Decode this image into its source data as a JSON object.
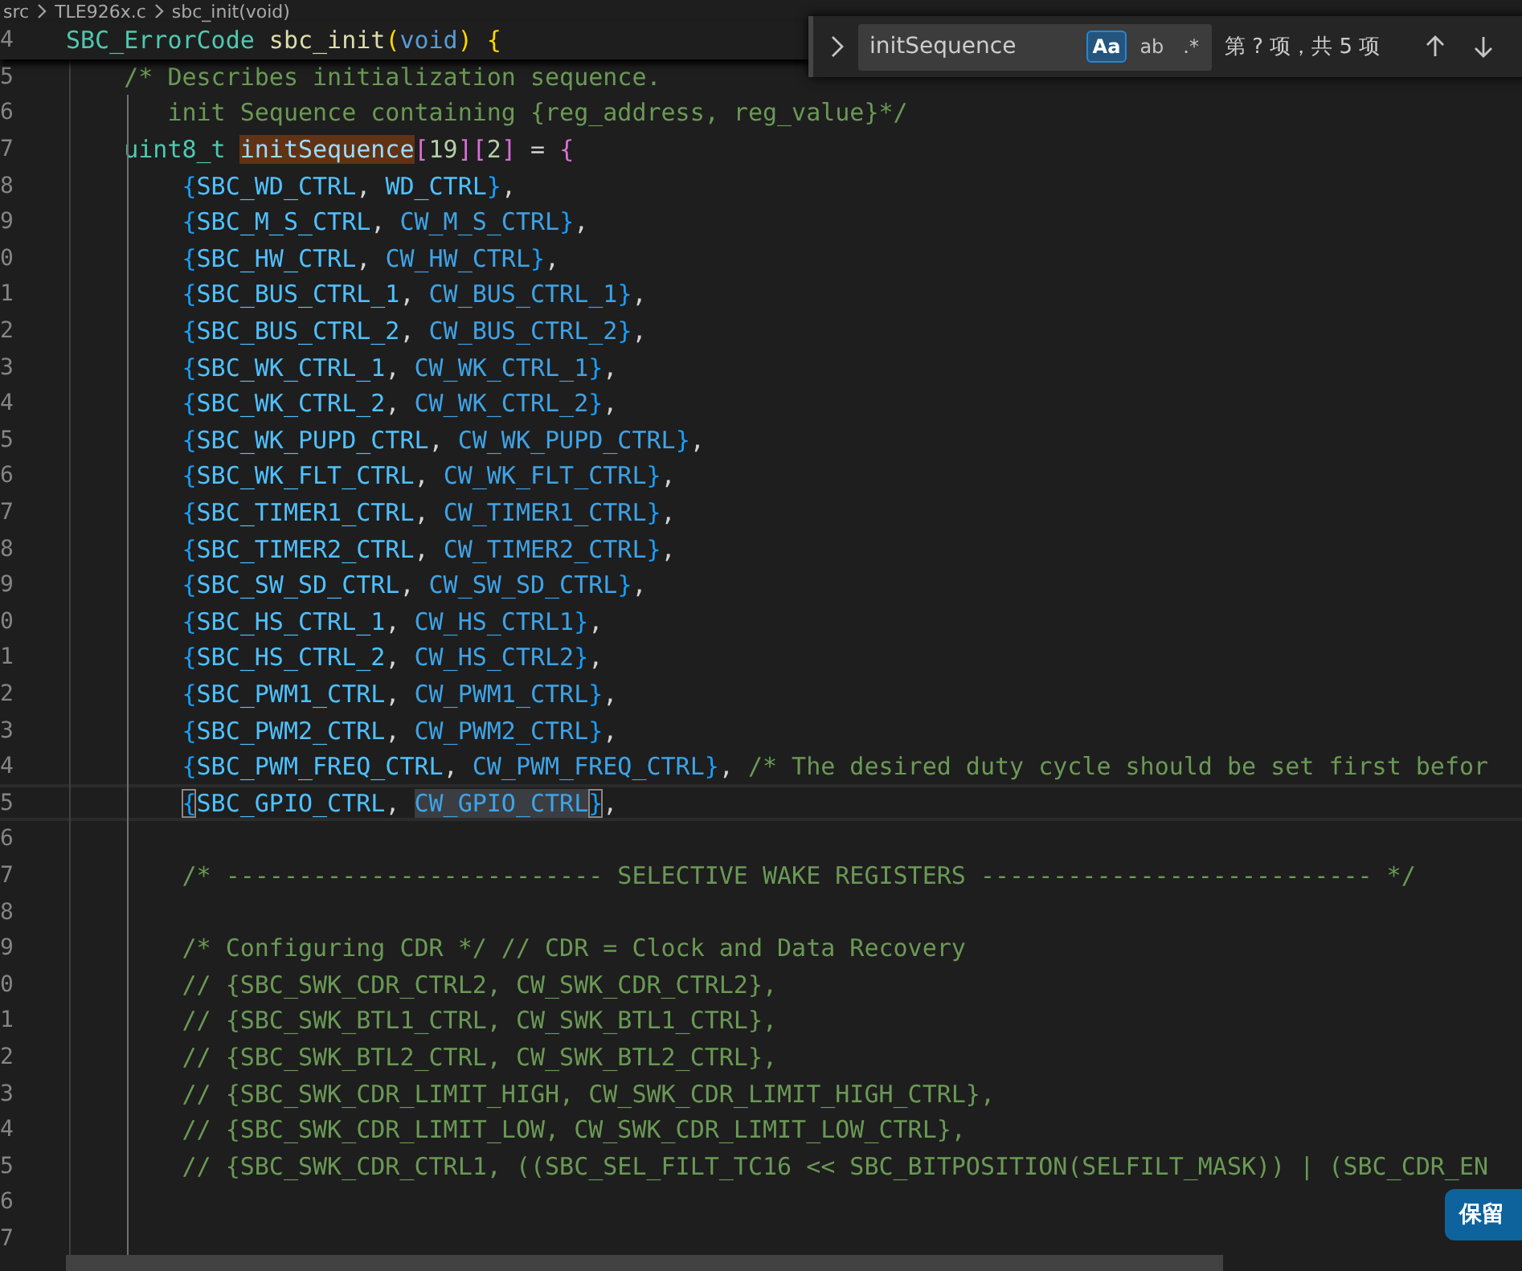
{
  "breadcrumb": [
    "src",
    "TLE926x.c",
    "sbc_init(void)"
  ],
  "sticky_line": {
    "number": "4",
    "tokens": [
      {
        "text": "SBC_ErrorCode",
        "kind": "type"
      },
      {
        "text": " sbc_init",
        "kind": "func"
      },
      {
        "text": "(",
        "kind": "p1"
      },
      {
        "text": "void",
        "kind": "kw"
      },
      {
        "text": ")",
        "kind": "p1"
      },
      {
        "text": " {",
        "kind": "p1"
      }
    ]
  },
  "lines": [
    {
      "number": "5",
      "current": false,
      "tokens": [
        {
          "text": "    /* Describes initialization sequence.",
          "kind": "comment"
        }
      ]
    },
    {
      "number": "6",
      "current": false,
      "tokens": [
        {
          "text": "       init Sequence containing {reg_address, reg_value}*/",
          "kind": "comment"
        }
      ]
    },
    {
      "number": "7",
      "current": false,
      "tokens": [
        {
          "text": "    uint8_t ",
          "kind": "type"
        },
        {
          "text": "initSequence",
          "kind": "var",
          "find_match": true
        },
        {
          "text": "[",
          "kind": "p2"
        },
        {
          "text": "19",
          "kind": "num"
        },
        {
          "text": "]",
          "kind": "p2"
        },
        {
          "text": "[",
          "kind": "p2"
        },
        {
          "text": "2",
          "kind": "num"
        },
        {
          "text": "]",
          "kind": "p2"
        },
        {
          "text": " =",
          "kind": "plain"
        },
        {
          "text": " {",
          "kind": "p2"
        }
      ]
    },
    {
      "number": "8",
      "current": false,
      "tokens": [
        {
          "text": "        {",
          "kind": "p3"
        },
        {
          "text": "SBC_WD_CTRL",
          "kind": "const"
        },
        {
          "text": ",",
          "kind": "plain"
        },
        {
          "text": " WD_CTRL",
          "kind": "const"
        },
        {
          "text": "}",
          "kind": "p3"
        },
        {
          "text": ",",
          "kind": "plain"
        }
      ]
    },
    {
      "number": "9",
      "current": false,
      "tokens": [
        {
          "text": "        {",
          "kind": "p3"
        },
        {
          "text": "SBC_M_S_CTRL",
          "kind": "const"
        },
        {
          "text": ",",
          "kind": "plain"
        },
        {
          "text": " CW_M_S_CTRL",
          "kind": "macro"
        },
        {
          "text": "}",
          "kind": "p3"
        },
        {
          "text": ",",
          "kind": "plain"
        }
      ]
    },
    {
      "number": "0",
      "current": false,
      "tokens": [
        {
          "text": "        {",
          "kind": "p3"
        },
        {
          "text": "SBC_HW_CTRL",
          "kind": "const"
        },
        {
          "text": ",",
          "kind": "plain"
        },
        {
          "text": " CW_HW_CTRL",
          "kind": "macro"
        },
        {
          "text": "}",
          "kind": "p3"
        },
        {
          "text": ",",
          "kind": "plain"
        }
      ]
    },
    {
      "number": "1",
      "current": false,
      "tokens": [
        {
          "text": "        {",
          "kind": "p3"
        },
        {
          "text": "SBC_BUS_CTRL_1",
          "kind": "const"
        },
        {
          "text": ",",
          "kind": "plain"
        },
        {
          "text": " CW_BUS_CTRL_1",
          "kind": "macro"
        },
        {
          "text": "}",
          "kind": "p3"
        },
        {
          "text": ",",
          "kind": "plain"
        }
      ]
    },
    {
      "number": "2",
      "current": false,
      "tokens": [
        {
          "text": "        {",
          "kind": "p3"
        },
        {
          "text": "SBC_BUS_CTRL_2",
          "kind": "const"
        },
        {
          "text": ",",
          "kind": "plain"
        },
        {
          "text": " CW_BUS_CTRL_2",
          "kind": "macro"
        },
        {
          "text": "}",
          "kind": "p3"
        },
        {
          "text": ",",
          "kind": "plain"
        }
      ]
    },
    {
      "number": "3",
      "current": false,
      "tokens": [
        {
          "text": "        {",
          "kind": "p3"
        },
        {
          "text": "SBC_WK_CTRL_1",
          "kind": "const"
        },
        {
          "text": ",",
          "kind": "plain"
        },
        {
          "text": " CW_WK_CTRL_1",
          "kind": "macro"
        },
        {
          "text": "}",
          "kind": "p3"
        },
        {
          "text": ",",
          "kind": "plain"
        }
      ]
    },
    {
      "number": "4",
      "current": false,
      "tokens": [
        {
          "text": "        {",
          "kind": "p3"
        },
        {
          "text": "SBC_WK_CTRL_2",
          "kind": "const"
        },
        {
          "text": ",",
          "kind": "plain"
        },
        {
          "text": " CW_WK_CTRL_2",
          "kind": "macro"
        },
        {
          "text": "}",
          "kind": "p3"
        },
        {
          "text": ",",
          "kind": "plain"
        }
      ]
    },
    {
      "number": "5",
      "current": false,
      "tokens": [
        {
          "text": "        {",
          "kind": "p3"
        },
        {
          "text": "SBC_WK_PUPD_CTRL",
          "kind": "const"
        },
        {
          "text": ",",
          "kind": "plain"
        },
        {
          "text": " CW_WK_PUPD_CTRL",
          "kind": "macro"
        },
        {
          "text": "}",
          "kind": "p3"
        },
        {
          "text": ",",
          "kind": "plain"
        }
      ]
    },
    {
      "number": "6",
      "current": false,
      "tokens": [
        {
          "text": "        {",
          "kind": "p3"
        },
        {
          "text": "SBC_WK_FLT_CTRL",
          "kind": "const"
        },
        {
          "text": ",",
          "kind": "plain"
        },
        {
          "text": " CW_WK_FLT_CTRL",
          "kind": "macro"
        },
        {
          "text": "}",
          "kind": "p3"
        },
        {
          "text": ",",
          "kind": "plain"
        }
      ]
    },
    {
      "number": "7",
      "current": false,
      "tokens": [
        {
          "text": "        {",
          "kind": "p3"
        },
        {
          "text": "SBC_TIMER1_CTRL",
          "kind": "const"
        },
        {
          "text": ",",
          "kind": "plain"
        },
        {
          "text": " CW_TIMER1_CTRL",
          "kind": "macro"
        },
        {
          "text": "}",
          "kind": "p3"
        },
        {
          "text": ",",
          "kind": "plain"
        }
      ]
    },
    {
      "number": "8",
      "current": false,
      "tokens": [
        {
          "text": "        {",
          "kind": "p3"
        },
        {
          "text": "SBC_TIMER2_CTRL",
          "kind": "const"
        },
        {
          "text": ",",
          "kind": "plain"
        },
        {
          "text": " CW_TIMER2_CTRL",
          "kind": "macro"
        },
        {
          "text": "}",
          "kind": "p3"
        },
        {
          "text": ",",
          "kind": "plain"
        }
      ]
    },
    {
      "number": "9",
      "current": false,
      "tokens": [
        {
          "text": "        {",
          "kind": "p3"
        },
        {
          "text": "SBC_SW_SD_CTRL",
          "kind": "const"
        },
        {
          "text": ",",
          "kind": "plain"
        },
        {
          "text": " CW_SW_SD_CTRL",
          "kind": "macro"
        },
        {
          "text": "}",
          "kind": "p3"
        },
        {
          "text": ",",
          "kind": "plain"
        }
      ]
    },
    {
      "number": "0",
      "current": false,
      "tokens": [
        {
          "text": "        {",
          "kind": "p3"
        },
        {
          "text": "SBC_HS_CTRL_1",
          "kind": "const"
        },
        {
          "text": ",",
          "kind": "plain"
        },
        {
          "text": " CW_HS_CTRL1",
          "kind": "macro"
        },
        {
          "text": "}",
          "kind": "p3"
        },
        {
          "text": ",",
          "kind": "plain"
        }
      ]
    },
    {
      "number": "1",
      "current": false,
      "tokens": [
        {
          "text": "        {",
          "kind": "p3"
        },
        {
          "text": "SBC_HS_CTRL_2",
          "kind": "const"
        },
        {
          "text": ",",
          "kind": "plain"
        },
        {
          "text": " CW_HS_CTRL2",
          "kind": "macro"
        },
        {
          "text": "}",
          "kind": "p3"
        },
        {
          "text": ",",
          "kind": "plain"
        }
      ]
    },
    {
      "number": "2",
      "current": false,
      "tokens": [
        {
          "text": "        {",
          "kind": "p3"
        },
        {
          "text": "SBC_PWM1_CTRL",
          "kind": "const"
        },
        {
          "text": ",",
          "kind": "plain"
        },
        {
          "text": " CW_PWM1_CTRL",
          "kind": "macro"
        },
        {
          "text": "}",
          "kind": "p3"
        },
        {
          "text": ",",
          "kind": "plain"
        }
      ]
    },
    {
      "number": "3",
      "current": false,
      "tokens": [
        {
          "text": "        {",
          "kind": "p3"
        },
        {
          "text": "SBC_PWM2_CTRL",
          "kind": "const"
        },
        {
          "text": ",",
          "kind": "plain"
        },
        {
          "text": " CW_PWM2_CTRL",
          "kind": "macro"
        },
        {
          "text": "}",
          "kind": "p3"
        },
        {
          "text": ",",
          "kind": "plain"
        }
      ]
    },
    {
      "number": "4",
      "current": false,
      "tokens": [
        {
          "text": "        {",
          "kind": "p3"
        },
        {
          "text": "SBC_PWM_FREQ_CTRL",
          "kind": "const"
        },
        {
          "text": ",",
          "kind": "plain"
        },
        {
          "text": " CW_PWM_FREQ_CTRL",
          "kind": "macro"
        },
        {
          "text": "}",
          "kind": "p3"
        },
        {
          "text": ",",
          "kind": "plain"
        },
        {
          "text": " /* The desired duty cycle should be set first befor",
          "kind": "comment"
        }
      ]
    },
    {
      "number": "5",
      "current": true,
      "tokens": [
        {
          "text": "        {",
          "kind": "p3",
          "bracket_match": true
        },
        {
          "text": "SBC_GPIO_CTRL",
          "kind": "const"
        },
        {
          "text": ", ",
          "kind": "plain"
        },
        {
          "text": "CW_GPIO_CTRL",
          "kind": "macro",
          "selected_text": true
        },
        {
          "text": "}",
          "kind": "p3",
          "bracket_match": true
        },
        {
          "text": ",",
          "kind": "plain"
        }
      ]
    },
    {
      "number": "6",
      "current": false
    },
    {
      "number": "7",
      "current": false,
      "tokens": [
        {
          "text": "        /* -------------------------- SELECTIVE WAKE REGISTERS --------------------------- */",
          "kind": "comment"
        }
      ]
    },
    {
      "number": "8",
      "current": false
    },
    {
      "number": "9",
      "current": false,
      "tokens": [
        {
          "text": "        /* Configuring CDR */ // CDR = Clock and Data Recovery",
          "kind": "comment"
        }
      ]
    },
    {
      "number": "0",
      "current": false,
      "tokens": [
        {
          "text": "        // {SBC_SWK_CDR_CTRL2, CW_SWK_CDR_CTRL2},",
          "kind": "comment"
        }
      ]
    },
    {
      "number": "1",
      "current": false,
      "tokens": [
        {
          "text": "        // {SBC_SWK_BTL1_CTRL, CW_SWK_BTL1_CTRL},",
          "kind": "comment"
        }
      ]
    },
    {
      "number": "2",
      "current": false,
      "tokens": [
        {
          "text": "        // {SBC_SWK_BTL2_CTRL, CW_SWK_BTL2_CTRL},",
          "kind": "comment"
        }
      ]
    },
    {
      "number": "3",
      "current": false,
      "tokens": [
        {
          "text": "        // {SBC_SWK_CDR_LIMIT_HIGH, CW_SWK_CDR_LIMIT_HIGH_CTRL},",
          "kind": "comment"
        }
      ]
    },
    {
      "number": "4",
      "current": false,
      "tokens": [
        {
          "text": "        // {SBC_SWK_CDR_LIMIT_LOW, CW_SWK_CDR_LIMIT_LOW_CTRL},",
          "kind": "comment"
        }
      ]
    },
    {
      "number": "5",
      "current": false,
      "tokens": [
        {
          "text": "        // {SBC_SWK_CDR_CTRL1, ((SBC_SEL_FILT_TC16 << SBC_BITPOSITION(SELFILT_MASK)) | (SBC_CDR_EN",
          "kind": "comment"
        }
      ]
    },
    {
      "number": "6",
      "current": false
    },
    {
      "number": "7",
      "current": false
    }
  ],
  "find_widget": {
    "value": "initSequence",
    "toggles": [
      {
        "label": "Aa",
        "on": true
      },
      {
        "label": "ab",
        "on": false
      },
      {
        "label": ".*",
        "on": false
      }
    ],
    "result": "第 ? 项，共 5 项"
  },
  "keep_button": "保留"
}
